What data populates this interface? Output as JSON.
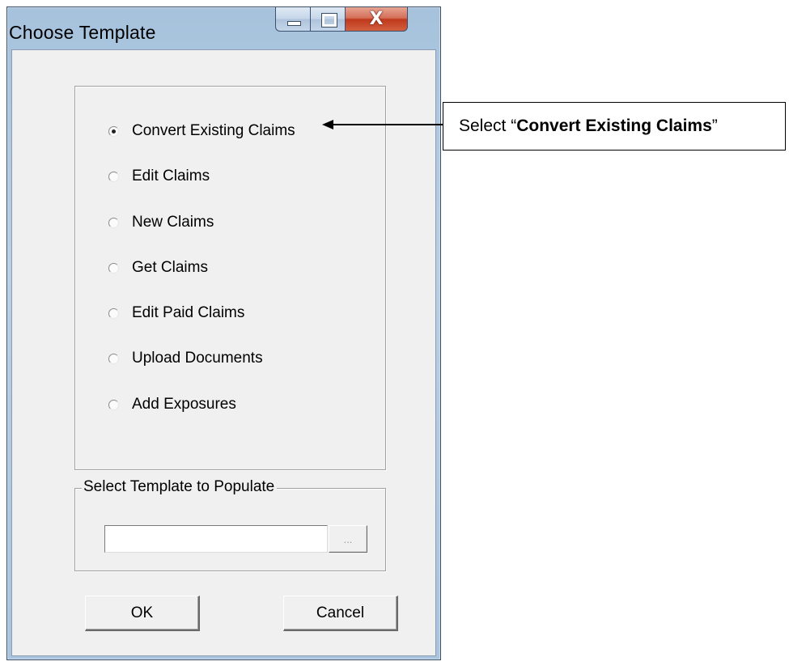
{
  "window": {
    "title": "Choose Template",
    "close_glyph": "X",
    "icons": {
      "minimize": "minimize-icon",
      "maximize": "maximize-icon",
      "close": "close-icon"
    }
  },
  "radio_options": [
    {
      "label": "Convert Existing Claims",
      "checked": true
    },
    {
      "label": "Edit Claims",
      "checked": false
    },
    {
      "label": "New Claims",
      "checked": false
    },
    {
      "label": "Get Claims",
      "checked": false
    },
    {
      "label": "Edit Paid Claims",
      "checked": false
    },
    {
      "label": "Upload Documents",
      "checked": false
    },
    {
      "label": "Add Exposures",
      "checked": false
    }
  ],
  "template_group": {
    "legend": "Select Template to Populate",
    "input_value": "",
    "browse_label": "..."
  },
  "buttons": {
    "ok": "OK",
    "cancel": "Cancel"
  },
  "annotation": {
    "prefix": "Select “",
    "bold": "Convert Existing Claims",
    "suffix": "”"
  },
  "colors": {
    "title_bar": "#b3cbe3",
    "client_bg": "#f0f0f0",
    "close_button": "#c9452a"
  }
}
